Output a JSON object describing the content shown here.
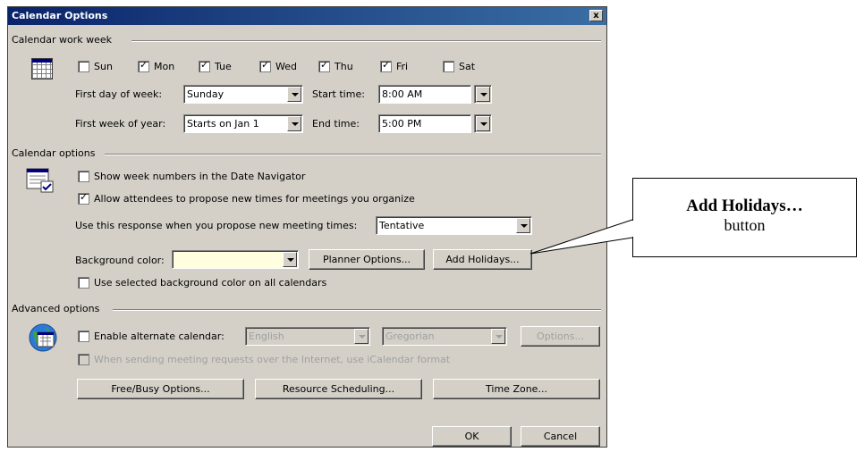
{
  "dialog": {
    "title": "Calendar Options",
    "close_label": "x"
  },
  "work_week": {
    "section_label": "Calendar work week",
    "days": [
      {
        "label": "Sun",
        "checked": false
      },
      {
        "label": "Mon",
        "checked": true
      },
      {
        "label": "Tue",
        "checked": true
      },
      {
        "label": "Wed",
        "checked": true
      },
      {
        "label": "Thu",
        "checked": true
      },
      {
        "label": "Fri",
        "checked": true
      },
      {
        "label": "Sat",
        "checked": false
      }
    ],
    "first_day_label": "First day of week:",
    "first_day_value": "Sunday",
    "first_week_label": "First week of year:",
    "first_week_value": "Starts on Jan 1",
    "start_time_label": "Start time:",
    "start_time_value": "8:00 AM",
    "end_time_label": "End time:",
    "end_time_value": "5:00 PM"
  },
  "cal_options": {
    "section_label": "Calendar options",
    "show_week_numbers": "Show week numbers in the Date Navigator",
    "allow_propose": "Allow attendees to propose new times for meetings you organize",
    "response_label": "Use this response when you propose new meeting times:",
    "response_value": "Tentative",
    "bg_color_label": "Background color:",
    "planner_button": "Planner Options...",
    "add_holidays_button": "Add Holidays...",
    "use_bg_all": "Use selected background color on all calendars"
  },
  "advanced": {
    "section_label": "Advanced options",
    "enable_alt_label": "Enable alternate calendar:",
    "language_value": "English",
    "calendar_value": "Gregorian",
    "options_button": "Options...",
    "icalendar_label": "When sending meeting requests over the Internet, use iCalendar format",
    "freebusy_button": "Free/Busy Options...",
    "resource_button": "Resource Scheduling...",
    "timezone_button": "Time Zone..."
  },
  "footer": {
    "ok": "OK",
    "cancel": "Cancel"
  },
  "callout": {
    "title": "Add Holidays…",
    "subtitle": "button"
  },
  "colors": {
    "title_bar": "#0a246a",
    "dialog_bg": "#d4d0c8",
    "bg_color_swatch": "#ffffe0"
  }
}
